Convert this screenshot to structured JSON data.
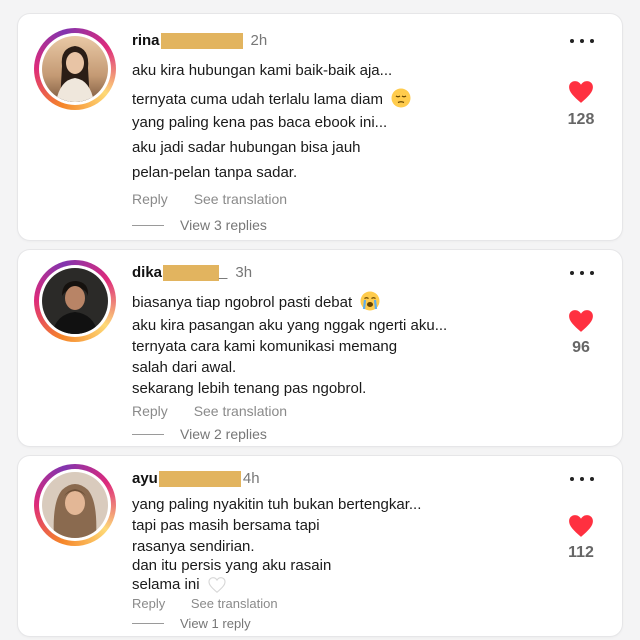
{
  "comments": [
    {
      "username": "rina",
      "time": "2h",
      "lines": [
        "aku kira hubungan kami baik-baik aja...",
        "ternyata cuma udah terlalu lama diam",
        "yang paling kena pas baca ebook ini...",
        "aku jadi sadar hubungan bisa jauh",
        "pelan-pelan tanpa sadar."
      ],
      "reply_label": "Reply",
      "translate_label": "See translation",
      "view_replies": "View 3 replies",
      "likes": "128",
      "emoji_icon": "pensive-face-icon"
    },
    {
      "username": "dika",
      "username_suffix": "_",
      "time": "3h",
      "lines": [
        "biasanya tiap ngobrol pasti debat",
        "aku kira pasangan aku yang nggak ngerti aku...",
        "ternyata cara kami komunikasi memang",
        "salah dari awal.",
        "sekarang lebih tenang pas ngobrol."
      ],
      "reply_label": "Reply",
      "translate_label": "See translation",
      "view_replies": "View 2 replies",
      "likes": "96",
      "emoji_icon": "loudly-crying-face-icon"
    },
    {
      "username": "ayu",
      "time": "4h",
      "lines": [
        "yang paling nyakitin tuh bukan bertengkar...",
        "tapi pas masih bersama tapi",
        "rasanya sendirian.",
        "dan itu persis yang aku rasain",
        "selama ini"
      ],
      "reply_label": "Reply",
      "translate_label": "See translation",
      "view_replies": "View 1 reply",
      "likes": "112",
      "emoji_icon": "white-heart-icon"
    }
  ],
  "colors": {
    "heart": "#ff3040",
    "redaction": "#e2b45f",
    "ring_start": "#f58529",
    "ring_mid": "#dd2a7b",
    "ring_end": "#8134af"
  }
}
